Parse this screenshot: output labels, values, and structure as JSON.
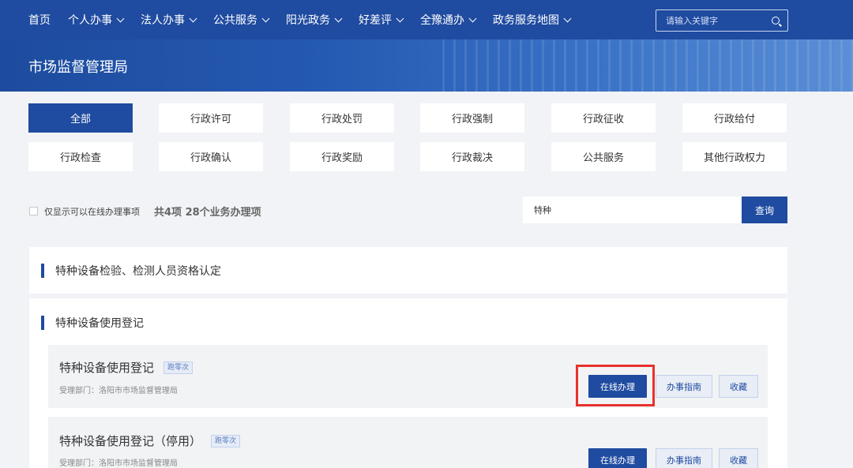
{
  "nav": {
    "items": [
      {
        "label": "首页",
        "dropdown": false
      },
      {
        "label": "个人办事",
        "dropdown": true
      },
      {
        "label": "法人办事",
        "dropdown": true
      },
      {
        "label": "公共服务",
        "dropdown": true
      },
      {
        "label": "阳光政务",
        "dropdown": true
      },
      {
        "label": "好差评",
        "dropdown": true
      },
      {
        "label": "全豫通办",
        "dropdown": true
      },
      {
        "label": "政务服务地图",
        "dropdown": true
      }
    ],
    "search_placeholder": "请输入关键字"
  },
  "banner": {
    "title": "市场监督管理局"
  },
  "categories": {
    "row1": [
      "全部",
      "行政许可",
      "行政处罚",
      "行政强制",
      "行政征收",
      "行政给付"
    ],
    "row2": [
      "行政检查",
      "行政确认",
      "行政奖励",
      "行政裁决",
      "公共服务",
      "其他行政权力"
    ],
    "active": "全部"
  },
  "filter": {
    "online_only_label": "仅显示可以在线办理事项",
    "online_only_checked": false,
    "count_text": "共4项 28个业务办理项"
  },
  "query": {
    "value": "特种",
    "button_label": "查询"
  },
  "sections": [
    {
      "title": "特种设备检验、检测人员资格认定"
    },
    {
      "title": "特种设备使用登记"
    }
  ],
  "items": [
    {
      "title": "特种设备使用登记",
      "tag": "跑零次",
      "dept": "受理部门：洛阳市市场监督管理局",
      "online_label": "在线办理",
      "guide_label": "办事指南",
      "fav_label": "收藏"
    },
    {
      "title": "特种设备使用登记（停用）",
      "tag": "跑零次",
      "dept": "受理部门：洛阳市市场监督管理局",
      "online_label": "在线办理",
      "guide_label": "办事指南",
      "fav_label": "收藏"
    }
  ],
  "colors": {
    "primary": "#1f4ba0",
    "highlight": "#e8322d",
    "page_bg": "#f1f3f6"
  }
}
